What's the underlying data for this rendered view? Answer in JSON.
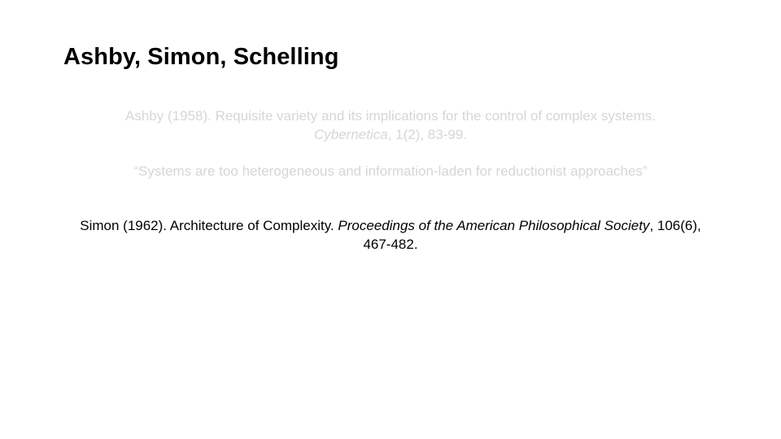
{
  "slide": {
    "title": "Ashby, Simon, Schelling"
  },
  "references": [
    {
      "id": "ashby",
      "state": "faded",
      "text_before": "Ashby (1958). Requisite variety and its implications for the control of complex systems.",
      "journal": "Cybernetica",
      "text_after": ", 1(2), 83-99."
    },
    {
      "id": "simon",
      "state": "active",
      "text_before": "Simon (1962). Architecture of Complexity. ",
      "journal": "Proceedings of the American Philosophical Society",
      "text_after": ", 106(6), 467-482."
    }
  ],
  "quote": {
    "state": "faded",
    "text": "“Systems are too heterogeneous and information-laden for reductionist approaches”"
  },
  "colors": {
    "title": "#000000",
    "active_text": "#000000",
    "faded_text": "#d6d6d6",
    "background": "#ffffff"
  }
}
